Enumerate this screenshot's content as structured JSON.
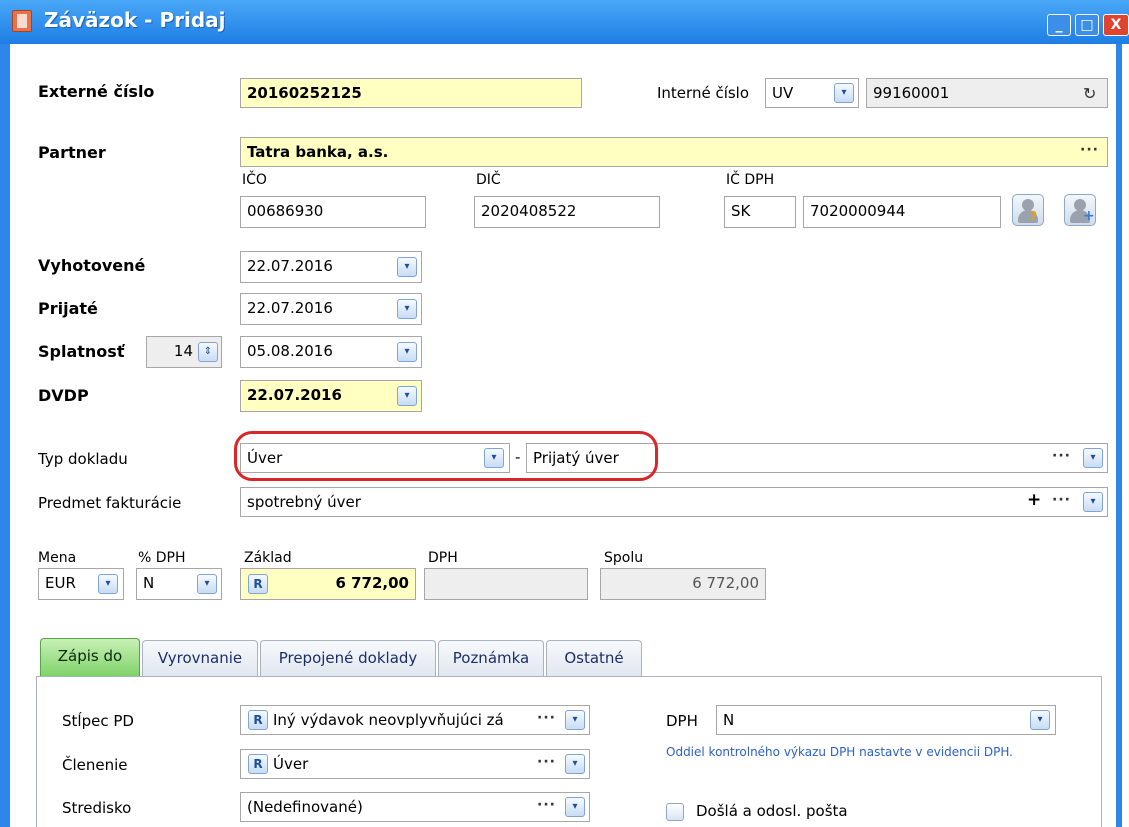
{
  "window": {
    "title": "Záväzok - Pridaj",
    "buttons": {
      "minimize": "_",
      "maximize": "□",
      "close": "X"
    }
  },
  "header": {
    "externe_cislo_label": "Externé číslo",
    "externe_cislo_value": "20160252125",
    "interne_cislo_label": "Interné číslo",
    "interne_prefix": "UV",
    "interne_value": "99160001"
  },
  "partner": {
    "label": "Partner",
    "value": "Tatra banka, a.s.",
    "ico_label": "IČO",
    "ico_value": "00686930",
    "dic_label": "DIČ",
    "dic_value": "2020408522",
    "icdph_label": "IČ DPH",
    "icdph_prefix": "SK",
    "icdph_value": "7020000944"
  },
  "dates": {
    "vyhotovene_label": "Vyhotovené",
    "vyhotovene_value": "22.07.2016",
    "prijate_label": "Prijaté",
    "prijate_value": "22.07.2016",
    "splatnost_label": "Splatnosť",
    "splatnost_days": "14",
    "splatnost_value": "05.08.2016",
    "dvdp_label": "DVDP",
    "dvdp_value": "22.07.2016"
  },
  "doc": {
    "typ_label": "Typ dokladu",
    "typ_value": "Úver",
    "typ_separator": "-",
    "typ_desc": "Prijatý úver",
    "predmet_label": "Predmet fakturácie",
    "predmet_value": "spotrebný úver",
    "plus": "+"
  },
  "amounts": {
    "mena_label": "Mena",
    "mena_value": "EUR",
    "dph_pct_label": "% DPH",
    "dph_pct_value": "N",
    "zaklad_label": "Základ",
    "zaklad_value": "6 772,00",
    "dph_label": "DPH",
    "dph_value": "",
    "spolu_label": "Spolu",
    "spolu_value": "6 772,00"
  },
  "tabs": [
    {
      "label": "Zápis do"
    },
    {
      "label": "Vyrovnanie"
    },
    {
      "label": "Prepojené doklady"
    },
    {
      "label": "Poznámka"
    },
    {
      "label": "Ostatné"
    }
  ],
  "zapis": {
    "stlpec_label": "Stĺpec PD",
    "stlpec_value": "Iný výdavok neovplyvňujúci zá",
    "clenenie_label": "Členenie",
    "clenenie_value": "Úver",
    "stredisko_label": "Stredisko",
    "stredisko_value": "(Nedefinované)",
    "dph_label": "DPH",
    "dph_value": "N",
    "info": "Oddiel kontrolného výkazu DPH nastavte v evidencii DPH.",
    "posta_label": "Došlá a odosl. pošta"
  },
  "icons": {
    "dropdown": "▾",
    "spinner": "⇕",
    "dots": "···",
    "reload": "↻",
    "r_badge": "R"
  }
}
